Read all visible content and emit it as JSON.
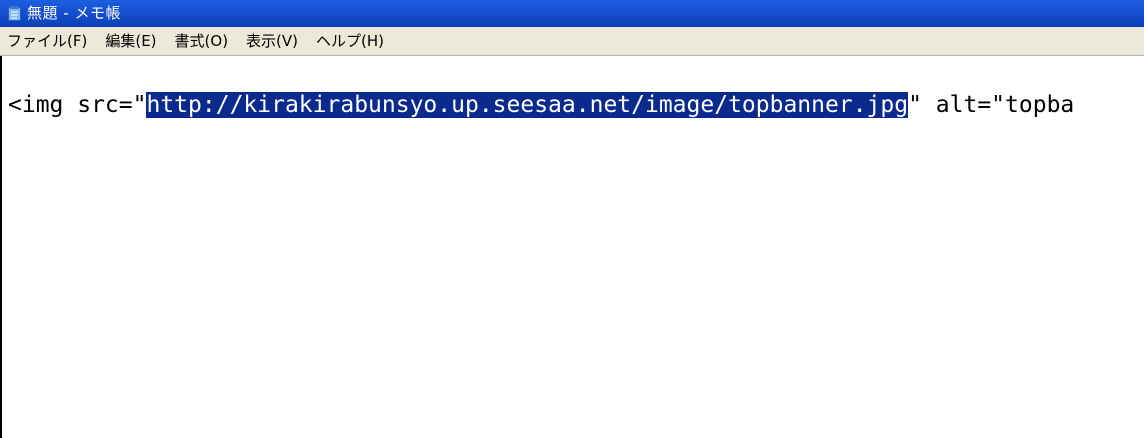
{
  "window": {
    "title": "無題 - メモ帳",
    "icon": "notepad-icon"
  },
  "menu": {
    "items": [
      {
        "label": "ファイル(F)"
      },
      {
        "label": "編集(E)"
      },
      {
        "label": "書式(O)"
      },
      {
        "label": "表示(V)"
      },
      {
        "label": "ヘルプ(H)"
      }
    ]
  },
  "editor": {
    "text_before": "<img src=\"",
    "selected_text": "http://kirakirabunsyo.up.seesaa.net/image/topbanner.jpg",
    "text_after": "\" alt=\"topba"
  },
  "colors": {
    "titlebar": "#1550cf",
    "menubar": "#ece9d8",
    "selection": "#0a2a8e"
  }
}
